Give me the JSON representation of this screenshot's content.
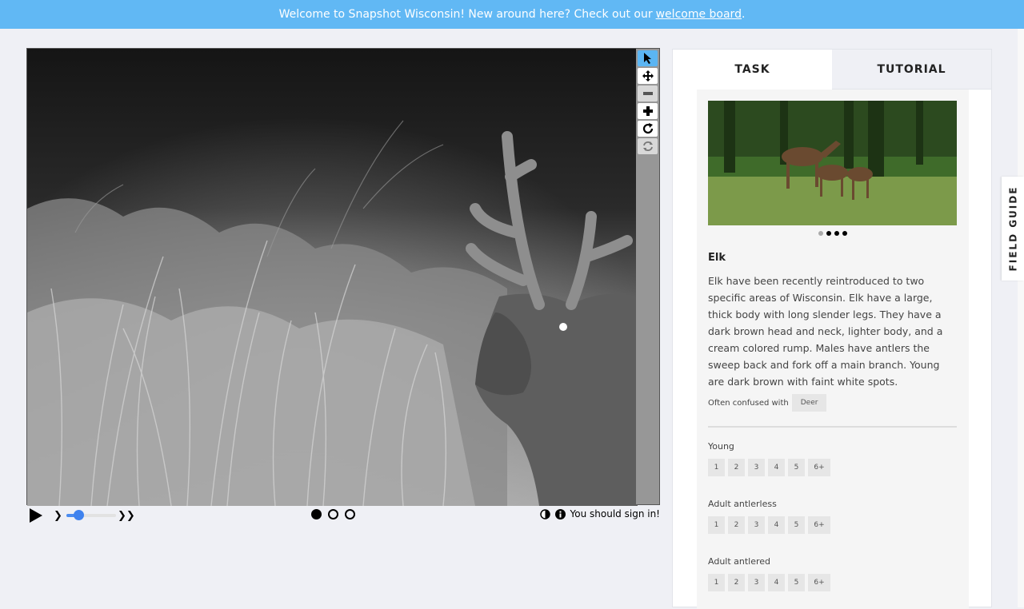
{
  "banner": {
    "text": "Welcome to Snapshot Wisconsin! New around here? Check out our",
    "link": "welcome board",
    "trail": "."
  },
  "viewer": {
    "tools": [
      "pointer-icon",
      "move-icon",
      "zoom-out-icon",
      "zoom-in-icon",
      "rotate-icon",
      "reset-icon"
    ],
    "frames": 3,
    "active_frame": 1,
    "speed_level": 0.2,
    "sign_in_text": "You should sign in!"
  },
  "panel": {
    "tabs": [
      {
        "label": "TASK",
        "active": true
      },
      {
        "label": "TUTORIAL",
        "active": false
      }
    ],
    "carousel_count": 4,
    "carousel_active": 1,
    "species": "Elk",
    "description": "Elk have been recently reintroduced to two specific areas of Wisconsin. Elk have a large, thick body with long slender legs. They have a dark brown head and neck, lighter body, and a cream colored rump. Males have antlers the sweep back and fork off a main branch. Young are dark brown with faint white spots.",
    "confused_label": "Often confused with",
    "confused_with": "Deer",
    "questions": [
      {
        "label": "Young",
        "options": [
          "1",
          "2",
          "3",
          "4",
          "5",
          "6+"
        ]
      },
      {
        "label": "Adult antlerless",
        "options": [
          "1",
          "2",
          "3",
          "4",
          "5",
          "6+"
        ]
      },
      {
        "label": "Adult antlered",
        "options": [
          "1",
          "2",
          "3",
          "4",
          "5",
          "6+"
        ]
      }
    ]
  },
  "field_guide": {
    "label": "FIELD GUIDE"
  }
}
